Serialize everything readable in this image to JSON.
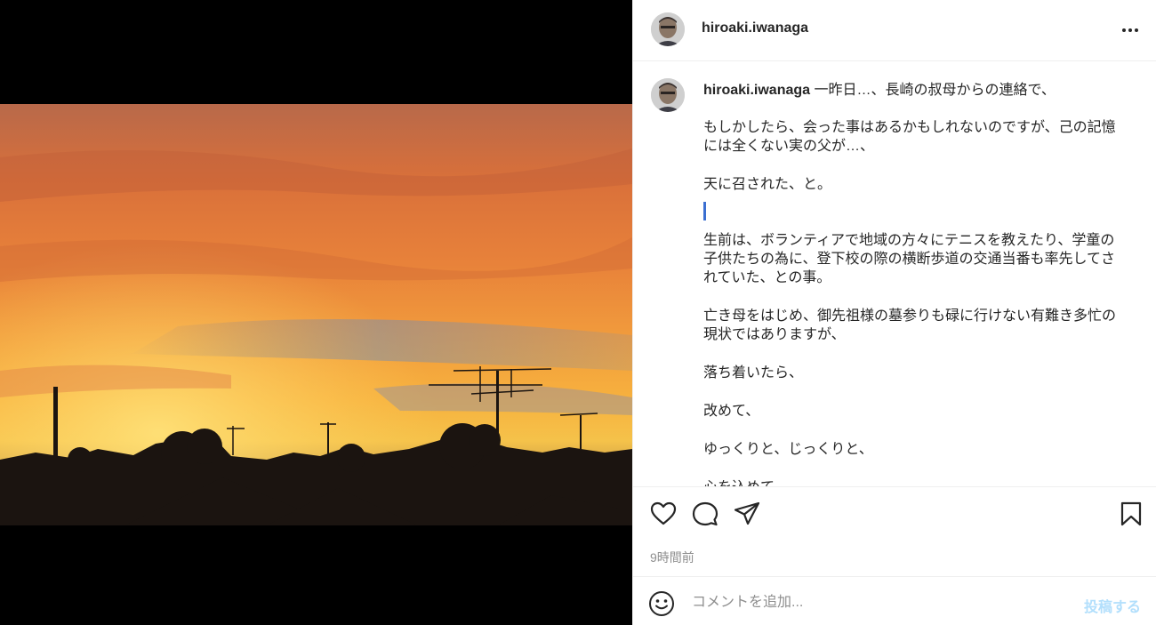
{
  "post": {
    "username": "hiroaki.iwanaga",
    "image_description_icon": "sunset-photo"
  },
  "caption": {
    "first_line": "一昨日…、長崎の叔母からの連絡で、",
    "paragraphs": [
      "もしかしたら、会った事はあるかもしれないのですが、己の記憶には全くない実の父が…、",
      "天に召された、と。",
      "生前は、ボランティアで地域の方々にテニスを教えたり、学童の子供たちの為に、登下校の際の横断歩道の交通当番も率先してされていた、との事。",
      "亡き母をはじめ、御先祖様の墓参りも碌に行けない有難き多忙の現状ではありますが、",
      "落ち着いたら、",
      "改めて、",
      "ゆっくりと、じっくりと、",
      "心を込めて、"
    ]
  },
  "actions": {
    "like_icon": "heart-icon",
    "comment_icon": "comment-icon",
    "share_icon": "send-icon",
    "save_icon": "bookmark-icon",
    "timestamp": "9時間前"
  },
  "composer": {
    "placeholder": "コメントを追加...",
    "post_label": "投稿する",
    "emoji_icon": "emoji-icon"
  },
  "colors": {
    "accent_disabled": "#b2dffc",
    "text": "#262626",
    "muted": "#8e8e8e",
    "divider": "#efefef"
  }
}
